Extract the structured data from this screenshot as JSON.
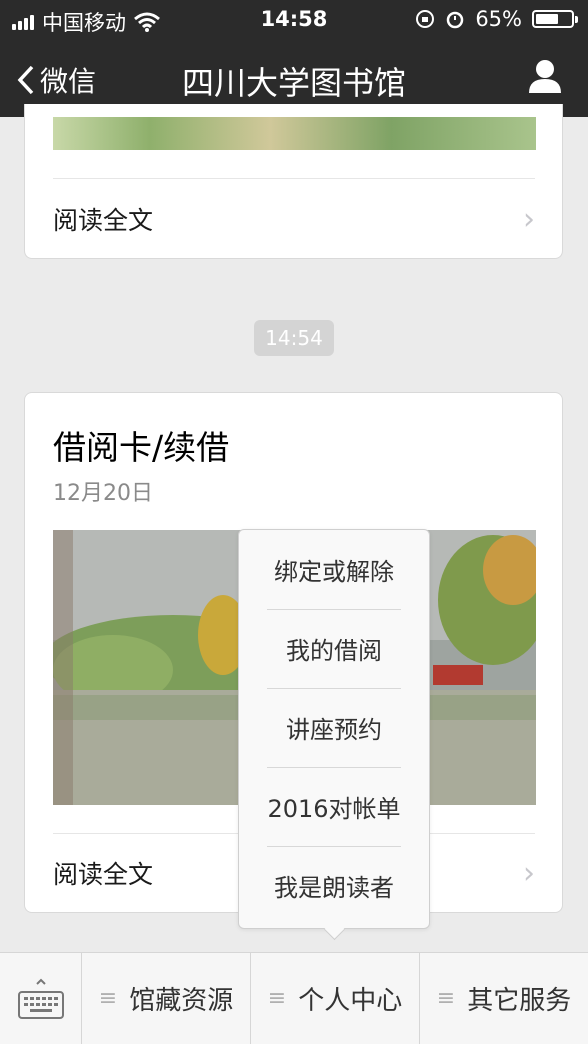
{
  "status_bar": {
    "carrier": "中国移动",
    "time": "14:58",
    "battery": "65%",
    "battery_level": 0.65
  },
  "nav": {
    "back_label": "微信",
    "title": "四川大学图书馆"
  },
  "card1": {
    "read_more": "阅读全文"
  },
  "timestamp": "14:54",
  "card2": {
    "title": "借阅卡/续借",
    "date": "12月20日",
    "read_more": "阅读全文"
  },
  "popup_menu": {
    "items": [
      "绑定或解除",
      "我的借阅",
      "讲座预约",
      "2016对帐单",
      "我是朗读者"
    ]
  },
  "bottom_menu": {
    "items": [
      "馆藏资源",
      "个人中心",
      "其它服务"
    ]
  },
  "colors": {
    "nav_bg": "#2b2b2b",
    "page_bg": "#ebebeb"
  }
}
